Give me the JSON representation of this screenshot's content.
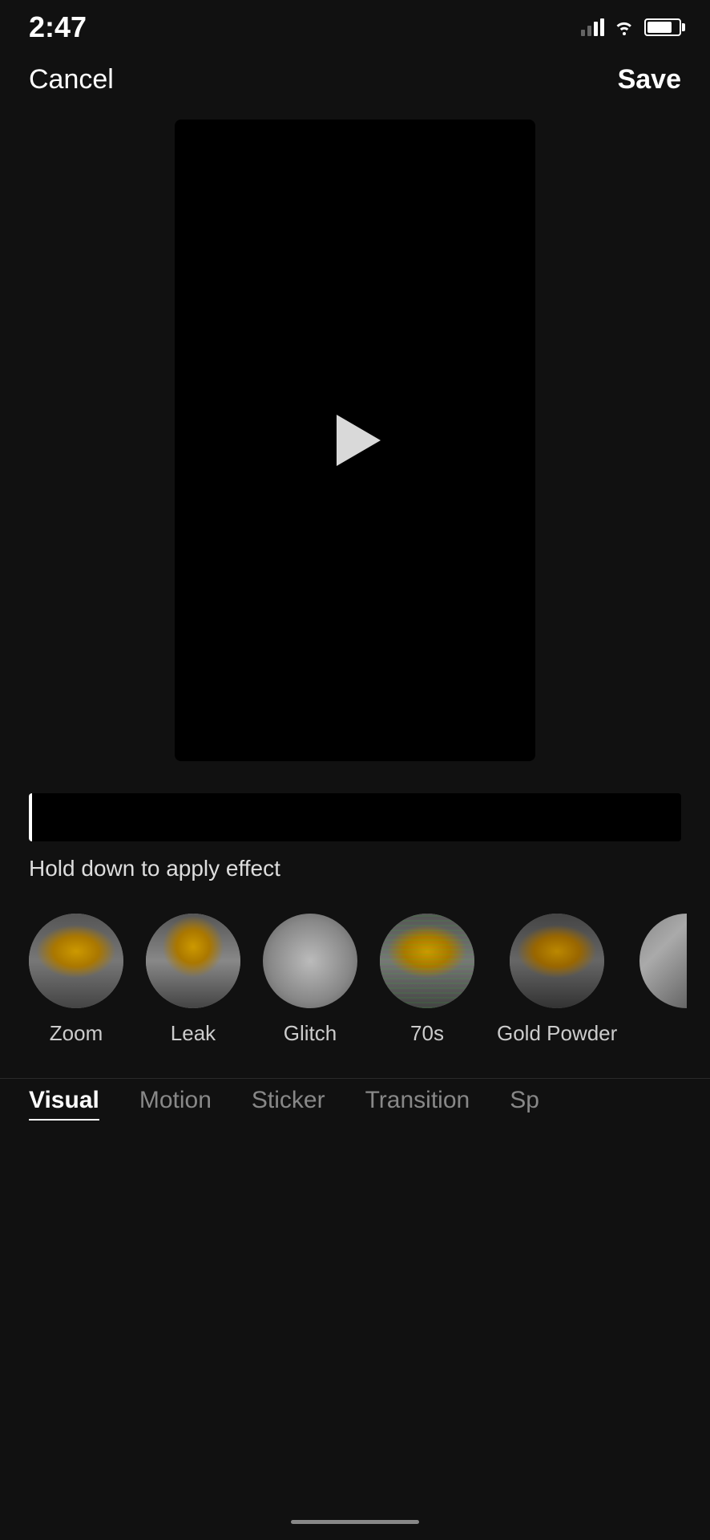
{
  "statusBar": {
    "time": "2:47",
    "signalBars": [
      3,
      2,
      4,
      4
    ],
    "battery": 80
  },
  "header": {
    "cancelLabel": "Cancel",
    "saveLabel": "Save"
  },
  "timeline": {
    "holdText": "Hold down to apply effect"
  },
  "effects": [
    {
      "id": "zoom",
      "label": "Zoom",
      "type": "zoom"
    },
    {
      "id": "leak",
      "label": "Leak",
      "type": "leak"
    },
    {
      "id": "glitch",
      "label": "Glitch",
      "type": "glitch"
    },
    {
      "id": "70s",
      "label": "70s",
      "type": "70s"
    },
    {
      "id": "gold-powder",
      "label": "Gold Powder",
      "type": "gold"
    }
  ],
  "tabs": [
    {
      "id": "visual",
      "label": "Visual",
      "active": true
    },
    {
      "id": "motion",
      "label": "Motion",
      "active": false
    },
    {
      "id": "sticker",
      "label": "Sticker",
      "active": false
    },
    {
      "id": "transition",
      "label": "Transition",
      "active": false
    },
    {
      "id": "sp",
      "label": "Sp",
      "active": false
    }
  ]
}
